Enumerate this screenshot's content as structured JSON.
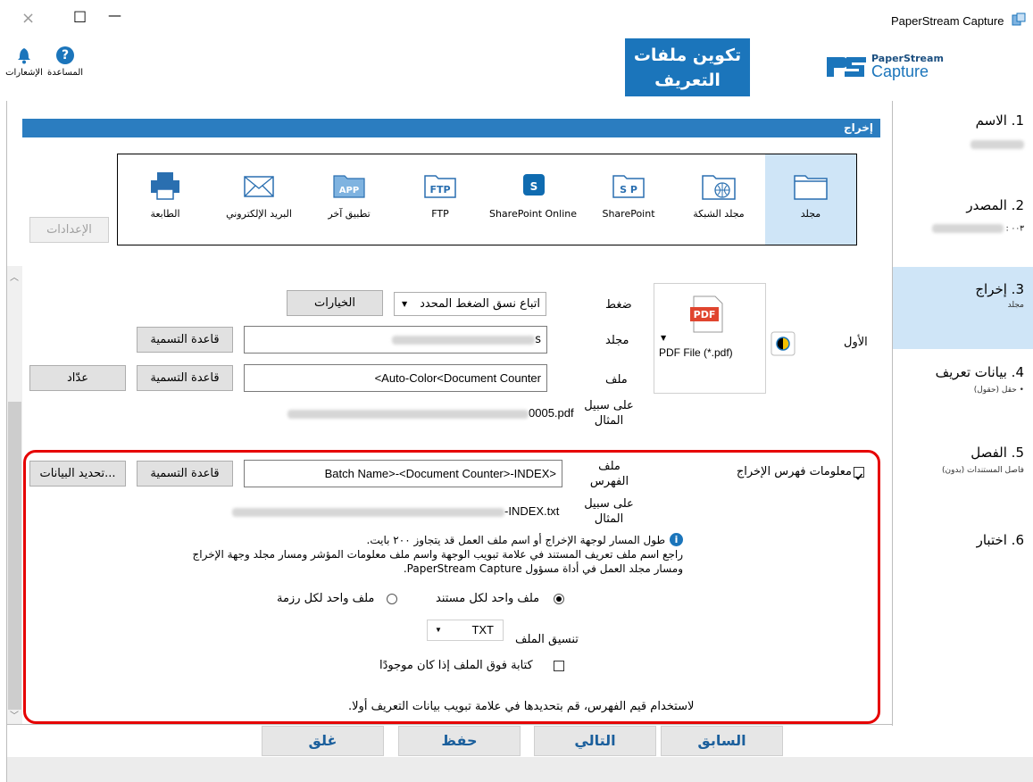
{
  "window": {
    "title": "PaperStream Capture",
    "controls": {
      "close": "×",
      "maximize": "□",
      "minimize": "—"
    }
  },
  "toolbar": {
    "help_label": "المساعدة",
    "notifications_label": "الإشعارات"
  },
  "header": {
    "title_line1": "تكوين ملفات",
    "title_line2": "التعريف"
  },
  "brand": {
    "line1": "PaperStream",
    "line2": "Capture"
  },
  "sidebar": {
    "items": [
      {
        "title": "1. الاسم",
        "sub": ""
      },
      {
        "title": "2. المصدر",
        "sub": ": ٠٠٣"
      },
      {
        "title": "3. إخراج",
        "sub": "مجلد"
      },
      {
        "title": "4. بيانات تعريف",
        "sub": "• حقل (حقول)"
      },
      {
        "title": "5. الفصل",
        "sub": "فاصل المستندات (بدون)"
      },
      {
        "title": "6. اختبار",
        "sub": ""
      }
    ]
  },
  "output_section": {
    "title": "إخراج"
  },
  "destinations": [
    {
      "label": "مجلد",
      "icon": "folder-icon"
    },
    {
      "label": "مجلد الشبكة",
      "icon": "network-folder-icon"
    },
    {
      "label": "SharePoint",
      "icon": "sharepoint-icon"
    },
    {
      "label": "SharePoint Online",
      "icon": "sharepoint-online-icon"
    },
    {
      "label": "FTP",
      "icon": "ftp-icon"
    },
    {
      "label": "تطبيق آخر",
      "icon": "app-icon"
    },
    {
      "label": "البريد الإلكتروني",
      "icon": "email-icon"
    },
    {
      "label": "الطابعة",
      "icon": "printer-icon"
    }
  ],
  "settings_button": "الإعدادات",
  "file_type": {
    "first_label": "الأول",
    "icon_text": "PDF",
    "selected": "PDF File (*.pdf)",
    "compression_label": "ضغط",
    "compression_value": "اتباع نسق الضغط المحدد",
    "options_button": "الخيارات",
    "folder_label": "مجلد",
    "folder_value_suffix": "s",
    "naming_rule_button": "قاعدة التسمية",
    "file_label": "ملف",
    "file_value": "<Auto-Color<Document Counter",
    "counter_button": "عدّاد",
    "example_label_1": "على سبيل",
    "example_label_2": "المثال",
    "example_value_suffix": "0005.pdf"
  },
  "index": {
    "checkbox_label": "معلومات فهرس الإخراج",
    "file_label_1": "ملف",
    "file_label_2": "الفهرس",
    "file_value": "Batch Name>-<Document Counter>-INDEX>",
    "naming_rule_button": "قاعدة التسمية",
    "update_data_button": "تحديد البيانات...",
    "example_label_1": "على سبيل",
    "example_label_2": "المثال",
    "example_value_suffix": "-INDEX.txt",
    "info_line1": "طول المسار لوجهة الإخراج أو اسم ملف العمل قد يتجاوز ٢٠٠ بايت.",
    "info_line2": "راجع اسم ملف تعريف المستند في علامة تبويب الوجهة واسم ملف معلومات المؤشر ومسار مجلد وجهة الإخراج",
    "info_line3": "ومسار مجلد العمل في أداة مسؤول PaperStream Capture.",
    "radio_per_document": "ملف واحد لكل مستند",
    "radio_per_batch": "ملف واحد لكل رزمة",
    "format_label": "تنسيق الملف",
    "format_value": "TXT",
    "overwrite_label": "كتابة فوق الملف إذا كان موجودًا",
    "footer_note": "لاستخدام قيم الفهرس، قم بتحديدها في علامة تبويب بيانات التعريف أولا."
  },
  "footer_buttons": {
    "back": "السابق",
    "next": "التالي",
    "save": "حفظ",
    "close": "غلق"
  },
  "colors": {
    "accent": "#1b75bb",
    "section_bar": "#2b7dc0",
    "highlight": "#cfe5f7",
    "annotation": "#e60000"
  }
}
